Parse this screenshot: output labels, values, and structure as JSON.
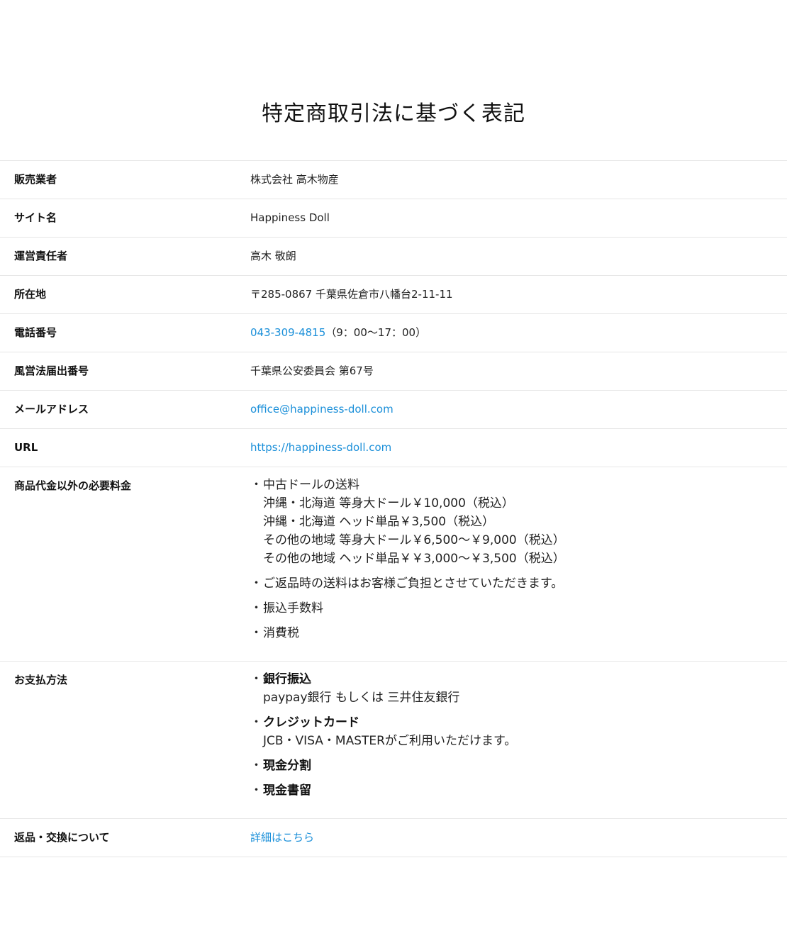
{
  "page": {
    "title": "特定商取引法に基づく表記"
  },
  "colors": {
    "link": "#1a8fd9",
    "border": "#e6e6e6"
  },
  "rows": {
    "seller": {
      "label": "販売業者",
      "value": "株式会社 高木物産"
    },
    "site_name": {
      "label": "サイト名",
      "value": "Happiness Doll"
    },
    "manager": {
      "label": "運営責任者",
      "value": "高木 敬朗"
    },
    "address": {
      "label": "所在地",
      "value": "〒285-0867 千葉県佐倉市八幡台2-11-11"
    },
    "phone": {
      "label": "電話番号",
      "number": "043-309-4815",
      "hours": "（9：00〜17：00）"
    },
    "license": {
      "label": "風営法届出番号",
      "value": "千葉県公安委員会 第67号"
    },
    "email": {
      "label": "メールアドレス",
      "value": "office@happiness-doll.com"
    },
    "url": {
      "label": "URL",
      "value": "https://happiness-doll.com"
    },
    "fees": {
      "label": "商品代金以外の必要料金",
      "items": {
        "shipping": {
          "title": "中古ドールの送料",
          "lines": [
            "沖縄・北海道 等身大ドール￥10,000（税込）",
            "沖縄・北海道 ヘッド単品￥3,500（税込）",
            "その他の地域 等身大ドール￥6,500〜￥9,000（税込）",
            "その他の地域 ヘッド単品￥￥3,000〜￥3,500（税込）"
          ]
        },
        "return_shipping": "ご返品時の送料はお客様ご負担とさせていただきます。",
        "transfer_fee": "振込手数料",
        "tax": "消費税"
      }
    },
    "payment": {
      "label": "お支払方法",
      "items": {
        "bank": {
          "title": "銀行振込",
          "detail": "paypay銀行 もしくは 三井住友銀行"
        },
        "card": {
          "title": "クレジットカード",
          "detail": "JCB・VISA・MASTERがご利用いただけます。"
        },
        "cash_installment": {
          "title": "現金分割"
        },
        "cash_registered": {
          "title": "現金書留"
        }
      }
    },
    "returns": {
      "label": "返品・交換について",
      "link_text": "詳細はこちら"
    }
  }
}
